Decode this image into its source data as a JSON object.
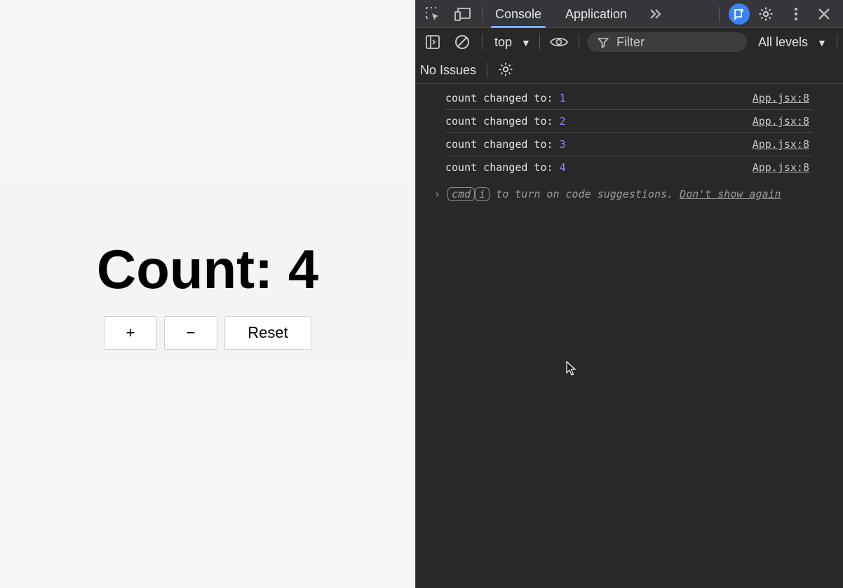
{
  "app": {
    "count_label": "Count: 4",
    "buttons": {
      "increment": "+",
      "decrement": "−",
      "reset": "Reset"
    }
  },
  "devtools": {
    "tabs": {
      "console": "Console",
      "application": "Application"
    },
    "toolbar": {
      "context": "top",
      "filter_placeholder": "Filter",
      "levels": "All levels"
    },
    "issues": "No Issues",
    "logs": [
      {
        "message": "count changed to: ",
        "value": "1",
        "source": "App.jsx:8"
      },
      {
        "message": "count changed to: ",
        "value": "2",
        "source": "App.jsx:8"
      },
      {
        "message": "count changed to: ",
        "value": "3",
        "source": "App.jsx:8"
      },
      {
        "message": "count changed to: ",
        "value": "4",
        "source": "App.jsx:8"
      }
    ],
    "hint": {
      "key1": "cmd",
      "key2": "i",
      "text": " to turn on code suggestions. ",
      "link": "Don't show again"
    },
    "colors": {
      "accent": "#7cacf8",
      "number": "#9980ff",
      "ai_badge": "#3b82f6"
    }
  }
}
